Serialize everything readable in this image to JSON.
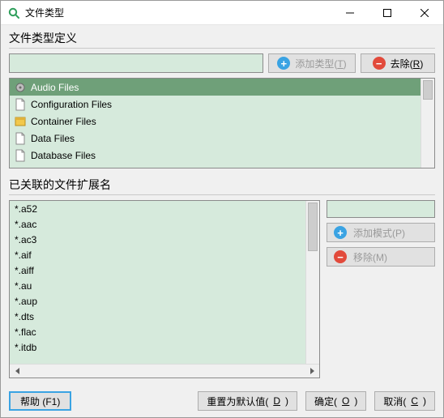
{
  "window": {
    "title": "文件类型"
  },
  "section1": {
    "title": "文件类型定义",
    "input_value": "",
    "add_label": "添加类型(",
    "add_key": "T",
    "add_suffix": ")",
    "remove_label": "去除(",
    "remove_key": "R",
    "remove_suffix": ")"
  },
  "type_list": {
    "items": [
      {
        "label": "Audio Files",
        "icon": "audio",
        "selected": true
      },
      {
        "label": "Configuration Files",
        "icon": "file",
        "selected": false
      },
      {
        "label": "Container Files",
        "icon": "container",
        "selected": false
      },
      {
        "label": "Data Files",
        "icon": "file",
        "selected": false
      },
      {
        "label": "Database Files",
        "icon": "file",
        "selected": false
      }
    ]
  },
  "section2": {
    "title": "已关联的文件扩展名"
  },
  "ext_list": {
    "items": [
      "*.a52",
      "*.aac",
      "*.ac3",
      "*.aif",
      "*.aiff",
      "*.au",
      "*.aup",
      "*.dts",
      "*.flac",
      "*.itdb"
    ]
  },
  "side": {
    "input_value": "",
    "add_label": "添加模式(",
    "add_key": "P",
    "add_suffix": ")",
    "remove_label": "移除(",
    "remove_key": "M",
    "remove_suffix": ")"
  },
  "footer": {
    "help": "帮助 (F1)",
    "reset_label": "重置为默认值(",
    "reset_key": "D",
    "reset_suffix": ")",
    "ok_label": "确定(",
    "ok_key": "O",
    "ok_suffix": ")",
    "cancel_label": "取消(",
    "cancel_key": "C",
    "cancel_suffix": ")"
  }
}
